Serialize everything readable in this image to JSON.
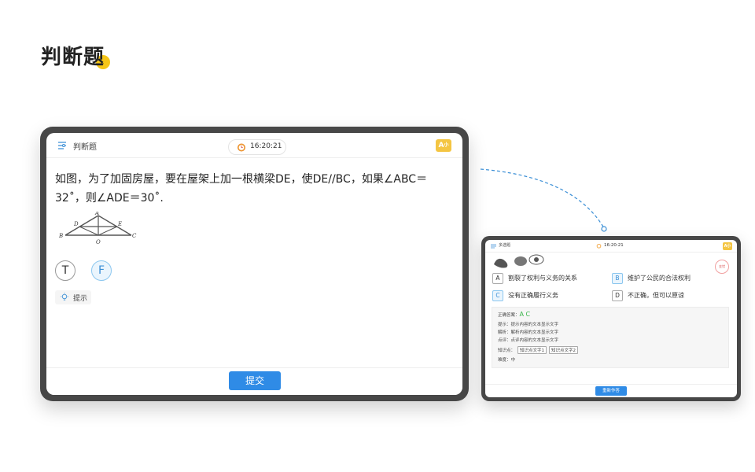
{
  "page": {
    "title": "判断题"
  },
  "big_tablet": {
    "header_title": "判断题",
    "timer": "16:20:21",
    "font_button": {
      "main": "A",
      "small": "小"
    },
    "question": "如图，为了加固房屋，要在屋架上加一根横梁DE，使DE//BC，如果∠ABC＝32˚，则∠ADE＝30˚.",
    "diagram_labels": {
      "a": "A",
      "b": "B",
      "c": "C",
      "d": "D",
      "e": "E",
      "o": "O"
    },
    "option_true": "T",
    "option_false": "F",
    "hint_label": "提示",
    "submit_label": "提交",
    "colors": {
      "accent": "#2f8be6",
      "selected_fill": "#eaf5fd",
      "frame": "#474747",
      "highlight": "#f5c518"
    }
  },
  "small_tablet": {
    "header_title": "多选题",
    "timer": "16:20:21",
    "font_button": "A小",
    "stamp": "变错",
    "options": [
      {
        "letter": "A",
        "text": "割裂了权利与义务的关系",
        "selected": false
      },
      {
        "letter": "B",
        "text": "维护了公民的合法权利",
        "selected": true
      },
      {
        "letter": "C",
        "text": "没有正确履行义务",
        "selected": true
      },
      {
        "letter": "D",
        "text": "不正确，但可以原谅",
        "selected": false
      }
    ],
    "answer_label": "正确答案：",
    "answer_value": "A C",
    "hint_line": "提示：提示内容的文本显示文字",
    "analysis_line": "解析：解析内容的文本显示文字",
    "comment_line": "点评：点评内容的文本显示文字",
    "knowledge_label": "知识点：",
    "knowledge_tags": [
      "知识点文字1",
      "知识点文字2"
    ],
    "difficulty_line": "难度：中",
    "redo_label": "重新作答"
  }
}
